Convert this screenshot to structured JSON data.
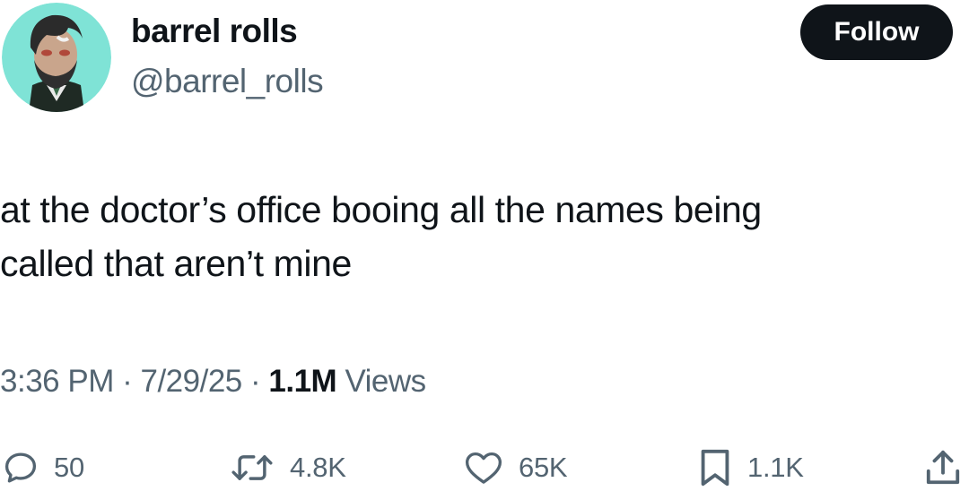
{
  "author": {
    "display_name": "barrel rolls",
    "handle": "@barrel_rolls"
  },
  "follow_button": {
    "label": "Follow"
  },
  "tweet": {
    "line1": "at the doctor’s office booing all the names being",
    "line2": "called that aren’t mine"
  },
  "meta": {
    "time": "3:36 PM",
    "separator": "·",
    "date": "7/29/25",
    "views_count": "1.1M",
    "views_label": "Views"
  },
  "actions": {
    "reply": {
      "icon": "reply-icon",
      "count": "50"
    },
    "retweet": {
      "icon": "retweet-icon",
      "count": "4.8K"
    },
    "like": {
      "icon": "heart-icon",
      "count": "65K"
    },
    "bookmark": {
      "icon": "bookmark-icon",
      "count": "1.1K"
    },
    "share": {
      "icon": "share-icon"
    }
  },
  "colors": {
    "text": "#0f1419",
    "secondary": "#536471",
    "button_bg": "#0f1419",
    "avatar_bg": "#7fe3d6"
  }
}
